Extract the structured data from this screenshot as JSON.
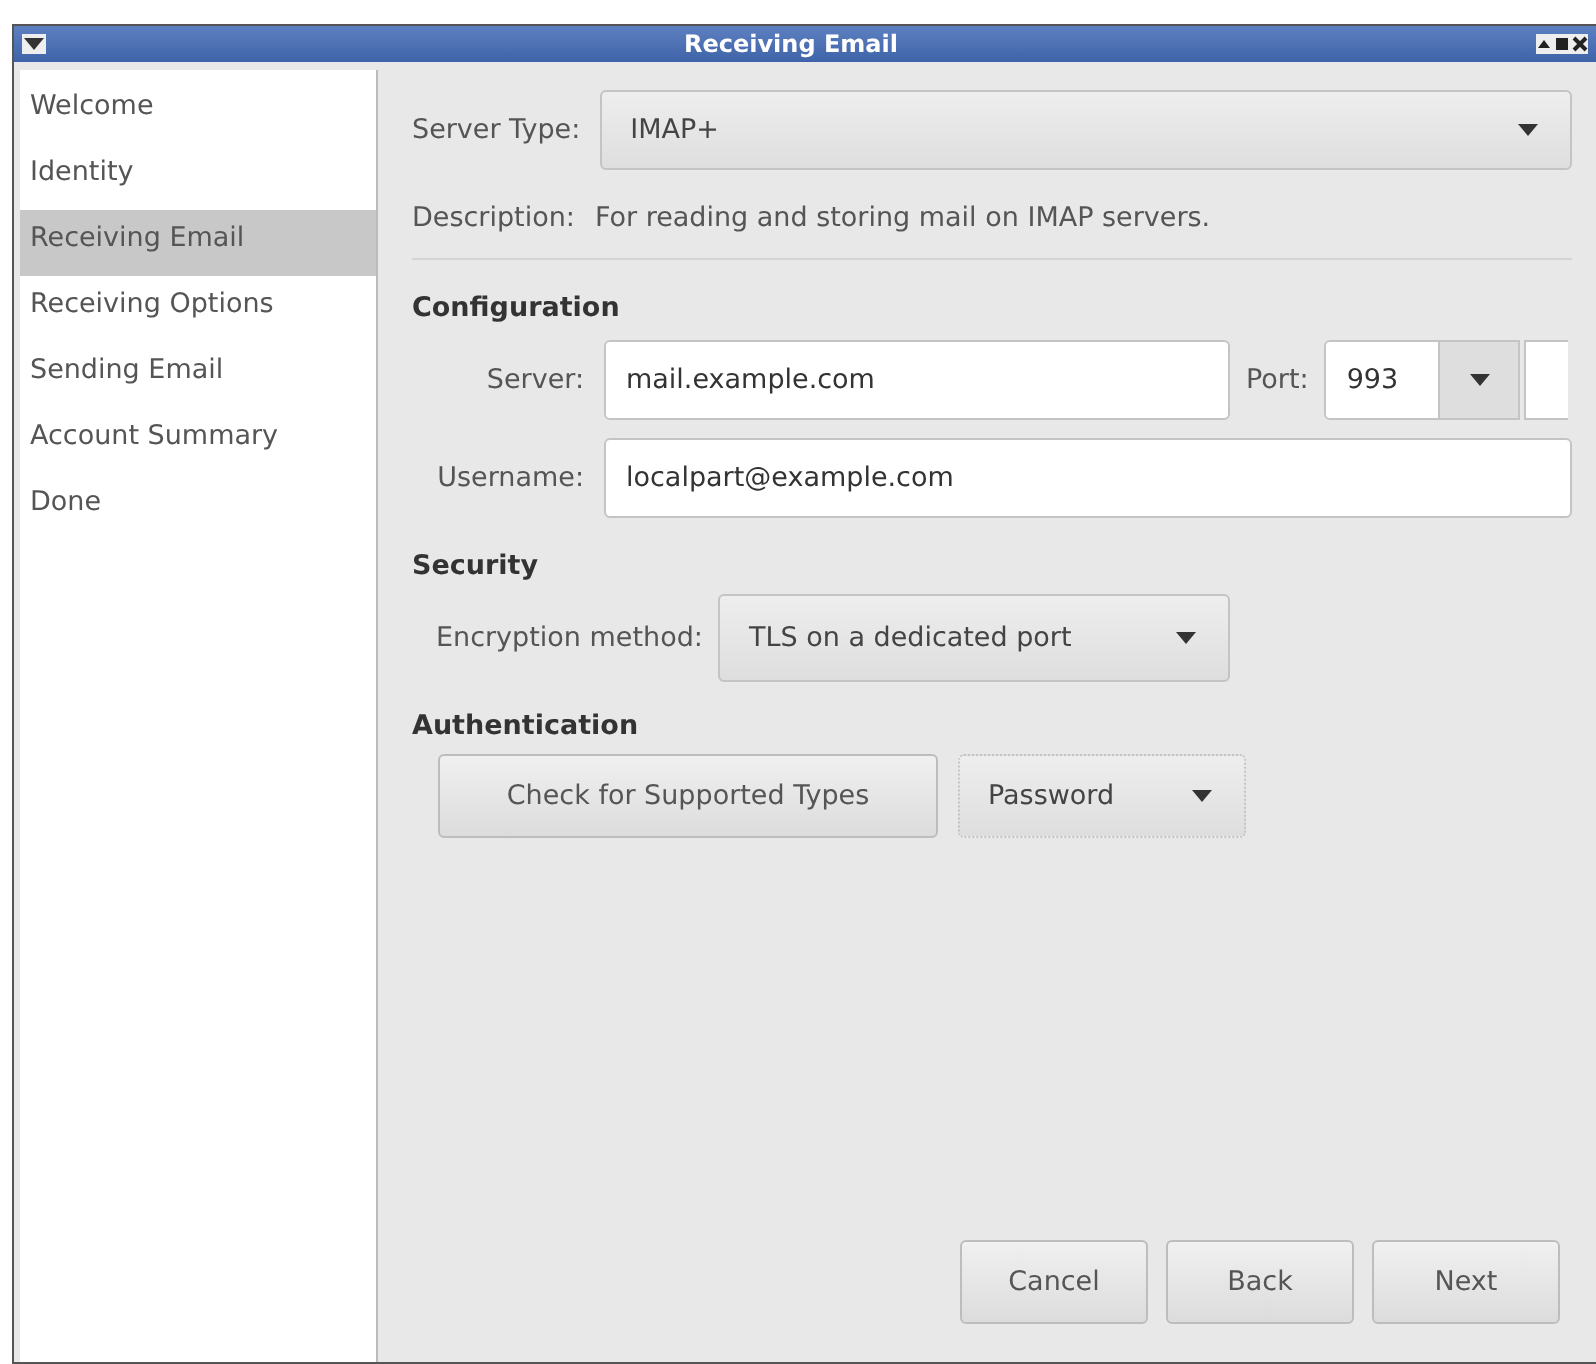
{
  "window": {
    "title": "Receiving Email"
  },
  "sidebar": {
    "items": [
      {
        "label": "Welcome",
        "selected": false
      },
      {
        "label": "Identity",
        "selected": false
      },
      {
        "label": "Receiving Email",
        "selected": true
      },
      {
        "label": "Receiving Options",
        "selected": false
      },
      {
        "label": "Sending Email",
        "selected": false
      },
      {
        "label": "Account Summary",
        "selected": false
      },
      {
        "label": "Done",
        "selected": false
      }
    ]
  },
  "server_type": {
    "label": "Server Type:",
    "value": "IMAP+"
  },
  "description": {
    "label": "Description:",
    "text": "For reading and storing mail on IMAP servers."
  },
  "configuration": {
    "heading": "Configuration",
    "server_label": "Server:",
    "server": "mail.example.com",
    "port_label": "Port:",
    "port": "993",
    "username_label": "Username:",
    "username": "localpart@example.com"
  },
  "security": {
    "heading": "Security",
    "encryption_label": "Encryption method:",
    "encryption": "TLS on a dedicated port"
  },
  "authentication": {
    "heading": "Authentication",
    "check_button": "Check for Supported Types",
    "method": "Password"
  },
  "buttons": [
    "Cancel",
    "Back",
    "Next"
  ]
}
